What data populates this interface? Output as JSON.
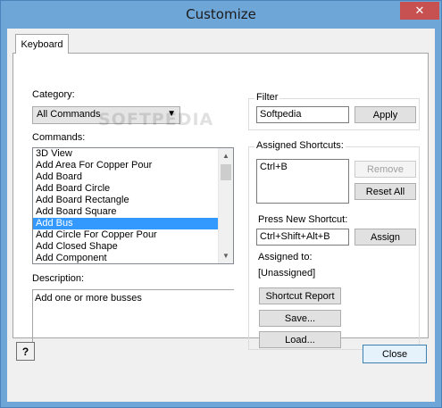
{
  "window": {
    "title": "Customize",
    "close_glyph": "✕"
  },
  "tab": {
    "label": "Keyboard"
  },
  "category": {
    "label": "Category:",
    "value": "All Commands"
  },
  "commands": {
    "label": "Commands:",
    "items": [
      "3D View",
      "Add Area For Copper Pour",
      "Add Board",
      "Add Board Circle",
      "Add Board Rectangle",
      "Add Board Square",
      "Add Bus",
      "Add Circle For Copper Pour",
      "Add Closed Shape",
      "Add Component"
    ],
    "selected_index": 6
  },
  "description": {
    "label": "Description:",
    "text": "Add one or more busses"
  },
  "filter": {
    "label": "Filter",
    "value": "Softpedia",
    "apply_label": "Apply"
  },
  "assigned": {
    "label": "Assigned Shortcuts:",
    "value": "Ctrl+B",
    "remove_label": "Remove",
    "reset_all_label": "Reset All"
  },
  "new_shortcut": {
    "label": "Press New Shortcut:",
    "value": "Ctrl+Shift+Alt+B",
    "assign_label": "Assign"
  },
  "assigned_to": {
    "label": "Assigned to:",
    "value": "[Unassigned]"
  },
  "buttons": {
    "shortcut_report": "Shortcut Report",
    "save": "Save...",
    "load": "Load...",
    "close": "Close",
    "help_glyph": "?"
  },
  "watermark": "SOFTPEDIA"
}
